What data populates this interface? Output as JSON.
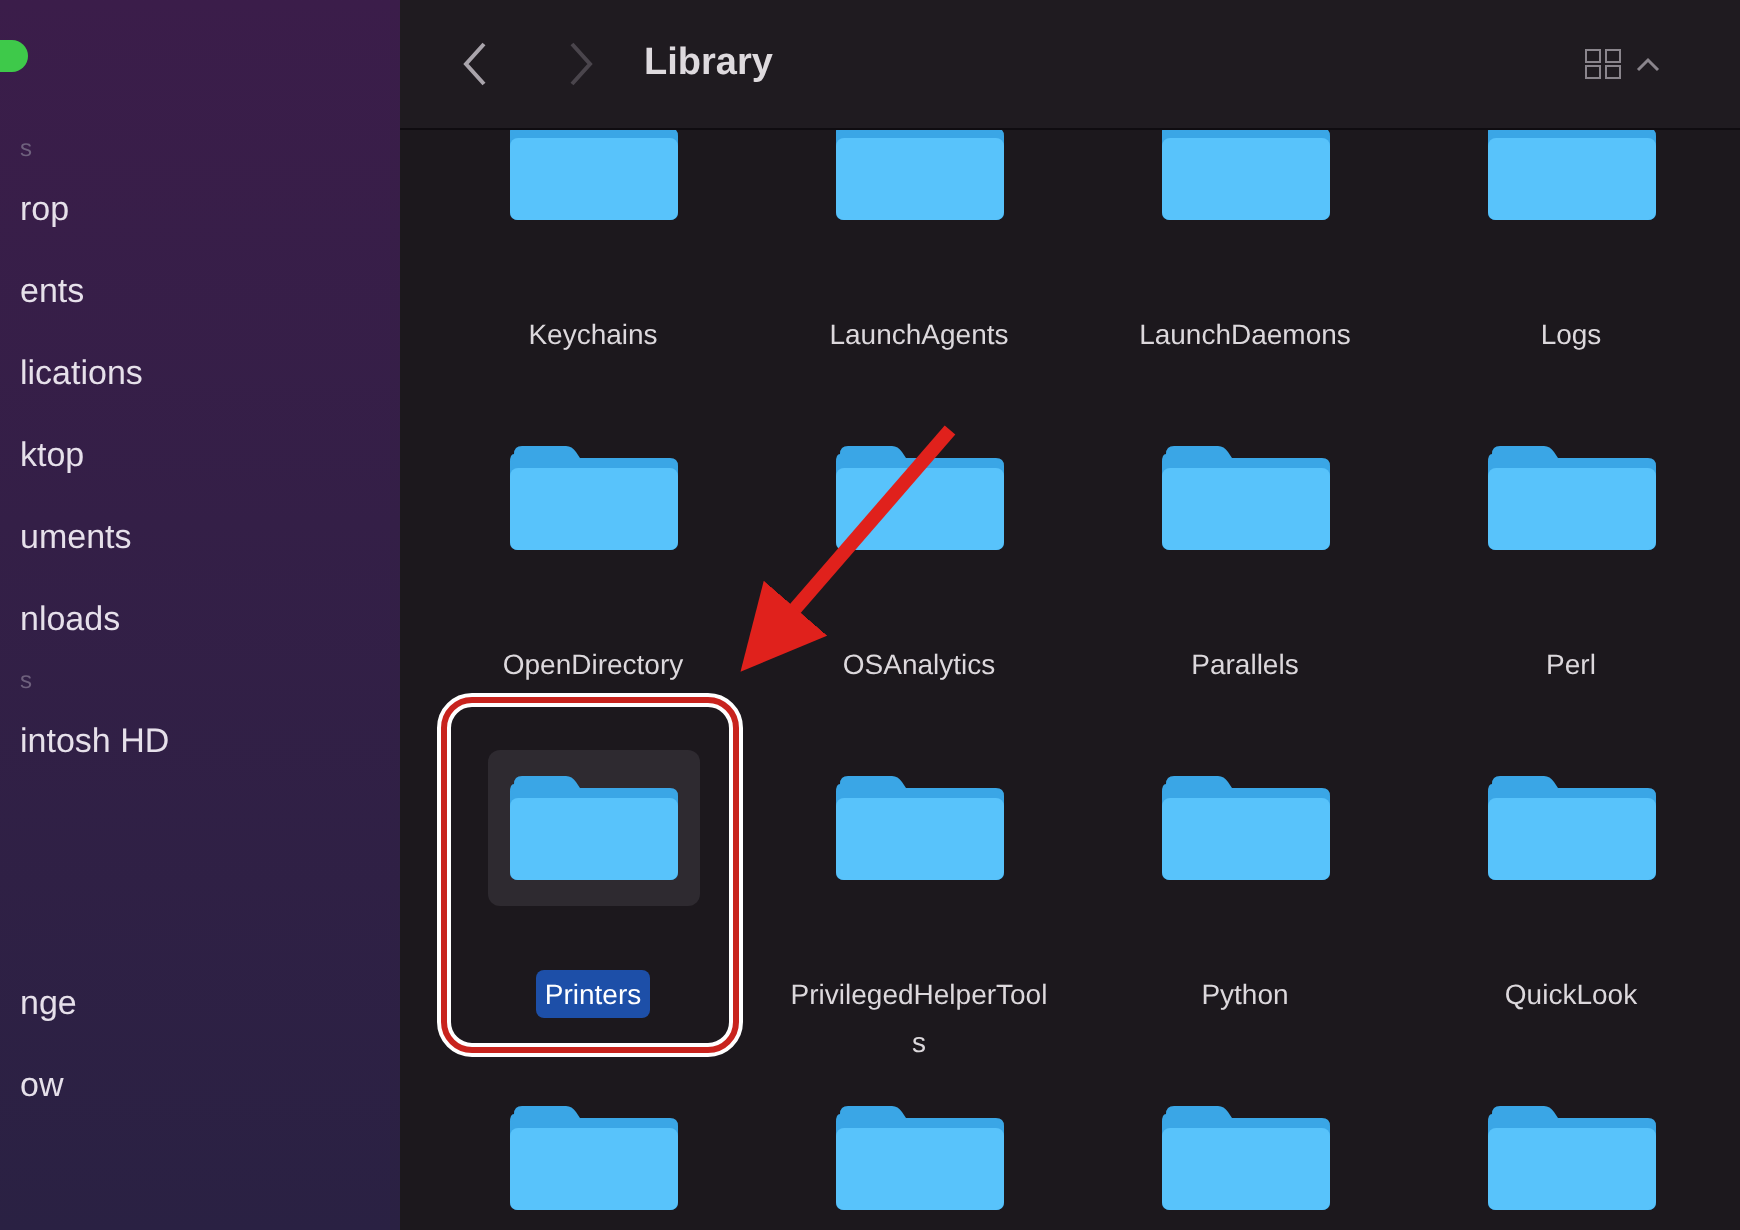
{
  "sidebar": {
    "items": [
      {
        "kind": "header",
        "label": "s"
      },
      {
        "kind": "item",
        "label": "rop"
      },
      {
        "kind": "item",
        "label": "ents"
      },
      {
        "kind": "item",
        "label": "lications"
      },
      {
        "kind": "item",
        "label": "ktop"
      },
      {
        "kind": "item",
        "label": "uments"
      },
      {
        "kind": "item",
        "label": "nloads"
      },
      {
        "kind": "header",
        "label": "s"
      },
      {
        "kind": "item",
        "label": "intosh HD"
      },
      {
        "kind": "gap"
      },
      {
        "kind": "item",
        "label": "nge"
      },
      {
        "kind": "item",
        "label": "ow"
      }
    ]
  },
  "toolbar": {
    "back": {
      "disabled": false
    },
    "forward": {
      "disabled": true
    },
    "title": "Library"
  },
  "folders": [
    [
      {
        "label": "Keychains",
        "selected": false
      },
      {
        "label": "LaunchAgents",
        "selected": false
      },
      {
        "label": "LaunchDaemons",
        "selected": false
      },
      {
        "label": "Logs",
        "selected": false
      }
    ],
    [
      {
        "label": "OpenDirectory",
        "selected": false
      },
      {
        "label": "OSAnalytics",
        "selected": false
      },
      {
        "label": "Parallels",
        "selected": false
      },
      {
        "label": "Perl",
        "selected": false
      }
    ],
    [
      {
        "label": "PrivilegedHelperTools",
        "selected": false
      },
      {
        "label": "Python",
        "selected": false
      },
      {
        "label": "QuickLook",
        "selected": false
      }
    ],
    [
      {
        "selected": false
      },
      {
        "selected": false
      },
      {
        "selected": false
      },
      {
        "selected": false
      }
    ]
  ],
  "selected_first": {
    "label": "Printers",
    "selected": true
  }
}
